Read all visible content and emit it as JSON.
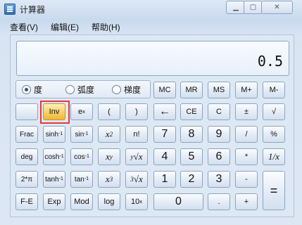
{
  "window": {
    "title": "计算器"
  },
  "menu": [
    "查看(V)",
    "编辑(E)",
    "帮助(H)"
  ],
  "display": {
    "value": "0.5"
  },
  "angle_mode": {
    "options": [
      "度",
      "弧度",
      "梯度"
    ],
    "selected": "度"
  },
  "memory_buttons": [
    "MC",
    "MR",
    "MS",
    "M+",
    "M-"
  ],
  "scientific": {
    "row1": [
      "",
      "Inv",
      "ex",
      "(",
      ")"
    ],
    "row2": [
      "Frac",
      "sinh-1",
      "sin-1",
      "x2",
      "n!"
    ],
    "row3": [
      "deg",
      "cosh-1",
      "cos-1",
      "xy",
      "y√x"
    ],
    "row4": [
      "2*π",
      "tanh-1",
      "tan-1",
      "x3",
      "3√x"
    ],
    "row5": [
      "F-E",
      "Exp",
      "Mod",
      "log",
      "10x"
    ]
  },
  "standard": {
    "row1": [
      "←",
      "CE",
      "C",
      "±",
      "√"
    ],
    "row2": [
      "7",
      "8",
      "9",
      "/",
      "%"
    ],
    "row3": [
      "4",
      "5",
      "6",
      "*",
      "1/x"
    ],
    "row4": [
      "1",
      "2",
      "3",
      "-",
      "="
    ],
    "row5": [
      "0",
      ".",
      "+"
    ]
  },
  "selection": {
    "highlighted_button": "Inv",
    "highlight_color": "#e23b3b"
  }
}
